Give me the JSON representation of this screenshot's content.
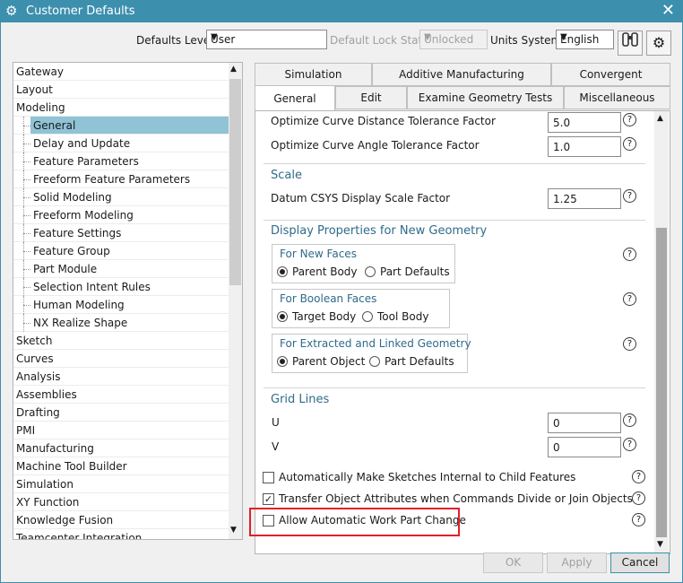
{
  "window": {
    "title": "Customer Defaults",
    "icon": "gear-icon",
    "close_icon": "close-icon"
  },
  "toolbar": {
    "defaults_level_label": "Defaults Level",
    "defaults_level_value": "User",
    "lock_state_label": "Default Lock State",
    "lock_state_value": "Unlocked",
    "units_label": "Units System",
    "units_value": "English",
    "find_icon": "binoculars-icon",
    "settings_icon": "gear-icon"
  },
  "tree": {
    "items": [
      "Gateway",
      "Layout",
      "Modeling",
      "General",
      "Delay and Update",
      "Feature Parameters",
      "Freeform Feature Parameters",
      "Solid Modeling",
      "Freeform Modeling",
      "Feature Settings",
      "Feature Group",
      "Part Module",
      "Selection Intent Rules",
      "Human Modeling",
      "NX Realize Shape",
      "Sketch",
      "Curves",
      "Analysis",
      "Assemblies",
      "Drafting",
      "PMI",
      "Manufacturing",
      "Machine Tool Builder",
      "Simulation",
      "XY Function",
      "Knowledge Fusion",
      "Teamcenter Integration"
    ],
    "selected": "General"
  },
  "tabs": {
    "row1": [
      "Simulation",
      "Additive Manufacturing",
      "Convergent"
    ],
    "row2": [
      "General",
      "Edit",
      "Examine Geometry Tests",
      "Miscellaneous"
    ],
    "active": "General"
  },
  "panel": {
    "curve_distance_label": "Optimize Curve Distance Tolerance Factor",
    "curve_distance_value": "5.0",
    "curve_angle_label": "Optimize Curve Angle Tolerance Factor",
    "curve_angle_value": "1.0",
    "scale_heading": "Scale",
    "datum_label": "Datum CSYS Display Scale Factor",
    "datum_value": "1.25",
    "display_heading": "Display Properties for New Geometry",
    "new_faces_heading": "For New Faces",
    "new_faces_opt1": "Parent Body",
    "new_faces_opt2": "Part Defaults",
    "boolean_heading": "For Boolean Faces",
    "boolean_opt1": "Target Body",
    "boolean_opt2": "Tool Body",
    "extracted_heading": "For Extracted and Linked Geometry",
    "extracted_opt1": "Parent Object",
    "extracted_opt2": "Part Defaults",
    "grid_heading": "Grid Lines",
    "grid_u_label": "U",
    "grid_u_value": "0",
    "grid_v_label": "V",
    "grid_v_value": "0",
    "check1_label": "Automatically Make Sketches Internal to Child Features",
    "check1_checked": false,
    "check2_label": "Transfer Object Attributes when Commands Divide or Join Objects",
    "check2_checked": true,
    "check3_label": "Allow Automatic Work Part Change",
    "check3_checked": false,
    "help_icon": "help-icon",
    "highlight_color": "#e0202a"
  },
  "footer": {
    "ok": "OK",
    "apply": "Apply",
    "cancel": "Cancel"
  },
  "colors": {
    "titlebar": "#3d8fae",
    "selection": "#8fc3d5",
    "heading": "#2f6b8b"
  }
}
